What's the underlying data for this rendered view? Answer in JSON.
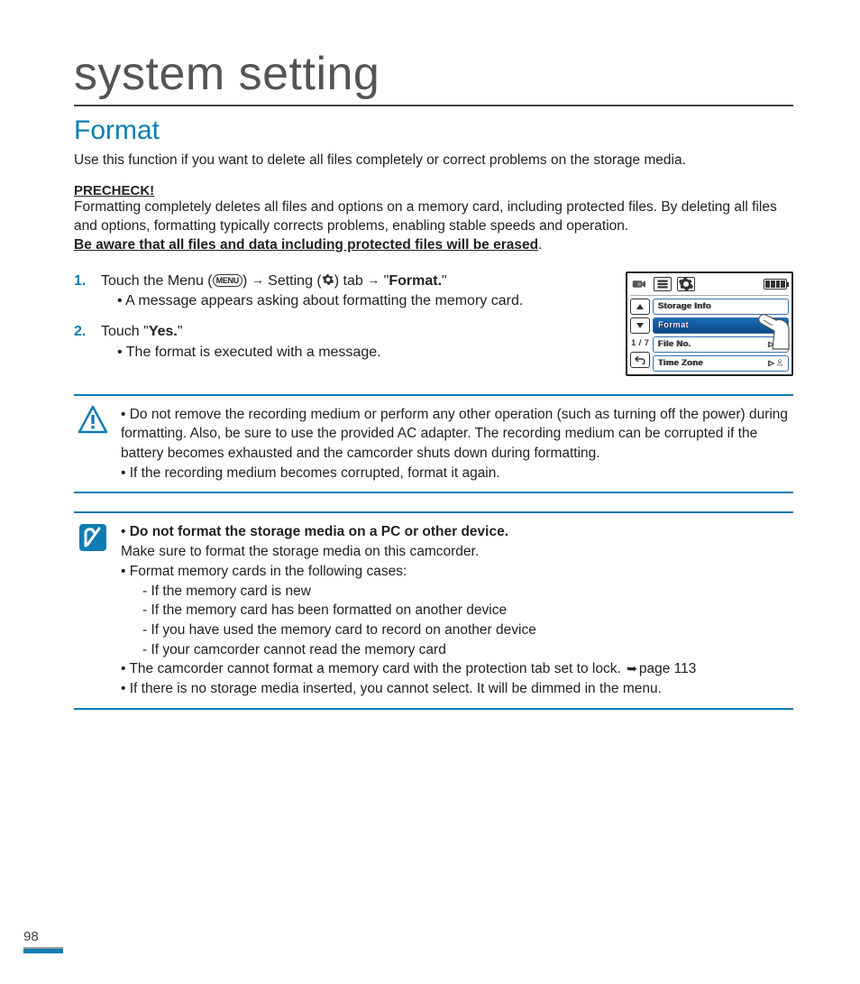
{
  "chapter_title": "system setting",
  "section_title": "Format",
  "intro": "Use this function if you want to delete all files completely or correct problems on the storage media.",
  "precheck": {
    "header": "PRECHECK!",
    "body": "Formatting completely deletes all files and options on a memory card, including protected files. By deleting all files and options, formatting typically corrects problems, enabling stable speeds and operation.",
    "warning": "Be aware that all files and data including protected files will be erased"
  },
  "steps": [
    {
      "num": "1.",
      "pre": "Touch the Menu (",
      "menu_label": "MENU",
      "mid1": ") ",
      "arrow": "→",
      "mid2": " Setting (",
      "mid3": ") tab ",
      "target": "Format.",
      "sub": "A message appears asking about formatting the memory card."
    },
    {
      "num": "2.",
      "pre": "Touch \"",
      "yes": "Yes.",
      "post": "\"",
      "sub": "The format is executed with a message."
    }
  ],
  "caution_box": [
    "Do not remove the recording medium or perform any other operation (such as turning off the power) during formatting. Also, be sure to use the provided AC adapter. The recording medium can be corrupted if the battery becomes exhausted and the camcorder shuts down during formatting.",
    "If the recording medium becomes corrupted, format it again."
  ],
  "note_box": {
    "lead_bold": "Do not format the storage media on a PC or other device.",
    "lead_rest": "Make sure to format the storage media on this camcorder.",
    "cases_intro": "Format memory cards in the following cases:",
    "cases": [
      "If the memory card is new",
      "If the memory card has been formatted on another device",
      "If you have used the memory card to record on another device",
      "If your camcorder cannot read the memory card"
    ],
    "lock_note_pre": "The camcorder cannot format a memory card with the protection tab set to lock. ",
    "lock_note_page": "page 113",
    "no_media": "If there is no storage media inserted, you cannot select. It will be dimmed in the menu."
  },
  "device": {
    "page_indicator": "1 / 7",
    "rows": [
      "Storage Info",
      "Format",
      "File No.",
      "Time Zone"
    ]
  },
  "page_number": "98"
}
